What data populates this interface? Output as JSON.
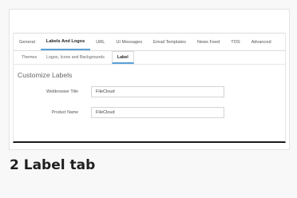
{
  "main_tabs": [
    "General",
    "Labels And Logos",
    "URL",
    "UI Messages",
    "Email Templates",
    "News Feed",
    "TOS",
    "Advanced"
  ],
  "active_main_tab": "Labels And Logos",
  "sub_tabs": [
    "Themes",
    "Logos, Icons and Backgrounds",
    "Label"
  ],
  "active_sub_tab": "Label",
  "section": {
    "title": "Customize Labels",
    "fields": [
      {
        "label": "Webbrowser Title",
        "value": "FileCloud"
      },
      {
        "label": "Product Name",
        "value": "FileCloud"
      }
    ]
  },
  "caption": "2 Label tab"
}
